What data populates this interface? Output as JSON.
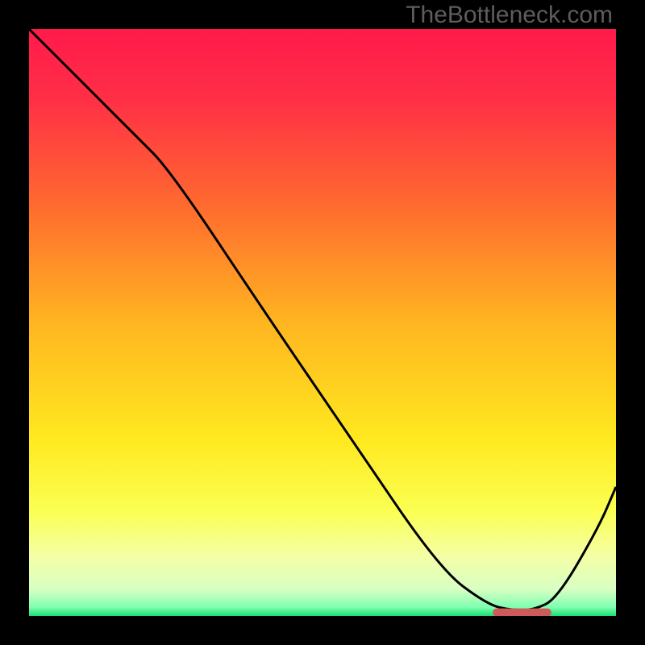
{
  "watermark": "TheBottleneck.com",
  "chart_data": {
    "type": "line",
    "title": "",
    "xlabel": "",
    "ylabel": "",
    "xlim": [
      0,
      100
    ],
    "ylim": [
      0,
      100
    ],
    "grid": false,
    "legend": false,
    "series": [
      {
        "name": "curve",
        "x": [
          0,
          8,
          18,
          24,
          40,
          55,
          70,
          78,
          82,
          86,
          90,
          97,
          100
        ],
        "y": [
          100,
          92,
          82,
          76,
          52,
          30,
          8,
          2,
          1,
          1,
          3,
          15,
          22
        ]
      }
    ],
    "highlight_segment": {
      "x0": 79,
      "x1": 89,
      "y": 0.6
    },
    "gradient_stops": [
      {
        "pos": 0.0,
        "color": "#ff1a4b"
      },
      {
        "pos": 0.12,
        "color": "#ff2f46"
      },
      {
        "pos": 0.3,
        "color": "#ff6a2f"
      },
      {
        "pos": 0.5,
        "color": "#ffb521"
      },
      {
        "pos": 0.7,
        "color": "#ffe91f"
      },
      {
        "pos": 0.82,
        "color": "#fbff52"
      },
      {
        "pos": 0.9,
        "color": "#f4ffa7"
      },
      {
        "pos": 0.955,
        "color": "#d7ffc3"
      },
      {
        "pos": 0.985,
        "color": "#7fffb0"
      },
      {
        "pos": 1.0,
        "color": "#18e074"
      }
    ],
    "highlight_color": "#cf5a5a",
    "curve_color": "#000000"
  }
}
